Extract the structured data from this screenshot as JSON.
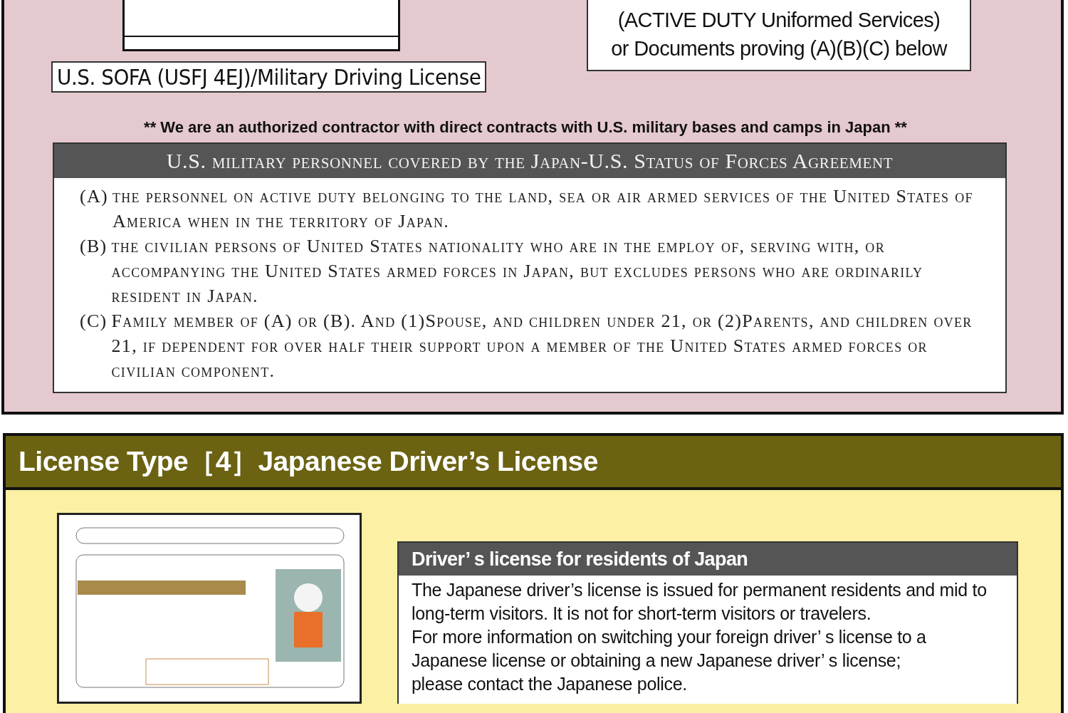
{
  "sofa_section": {
    "license_label": "U.S. SOFA (USFJ 4EJ)/Military Driving License",
    "id_box": [
      "(ACTIVE DUTY Uniformed Services)",
      "or Documents proving (A)(B)(C) below"
    ],
    "notice": "** We are an authorized contractor with direct contracts with U.S. military bases and camps in Japan **",
    "table": {
      "title": "U.S. military personnel covered by the Japan-U.S. Status of Forces Agreement",
      "items": [
        {
          "marker": "(A)",
          "text": "the personnel on active duty belonging to the land, sea or air armed services of the United States of America when in the territory of Japan."
        },
        {
          "marker": "(B)",
          "text": "the civilian persons of United States nationality who are in the employ of, serving with, or accompanying the United States armed forces in Japan, but excludes persons who are ordinarily resident in Japan."
        },
        {
          "marker": "(C)",
          "text": "Family member of (A) or (B). And (1)Spouse, and children under 21, or (2)Parents, and children over 21, if dependent for over half their support upon a member of the United States armed forces or civilian component."
        }
      ]
    }
  },
  "japan_section": {
    "title": "License Type［4］Japanese Driver’s License",
    "info": {
      "title": "Driver’ s license for residents of Japan",
      "lines": [
        "The Japanese driver’s license is issued for permanent residents and mid to long-term visitors. It is not for short-term visitors or travelers.",
        "For more information on switching your foreign driver’ s license to a Japanese license or obtaining a new Japanese driver’ s license;",
        "please contact the Japanese police."
      ]
    }
  }
}
